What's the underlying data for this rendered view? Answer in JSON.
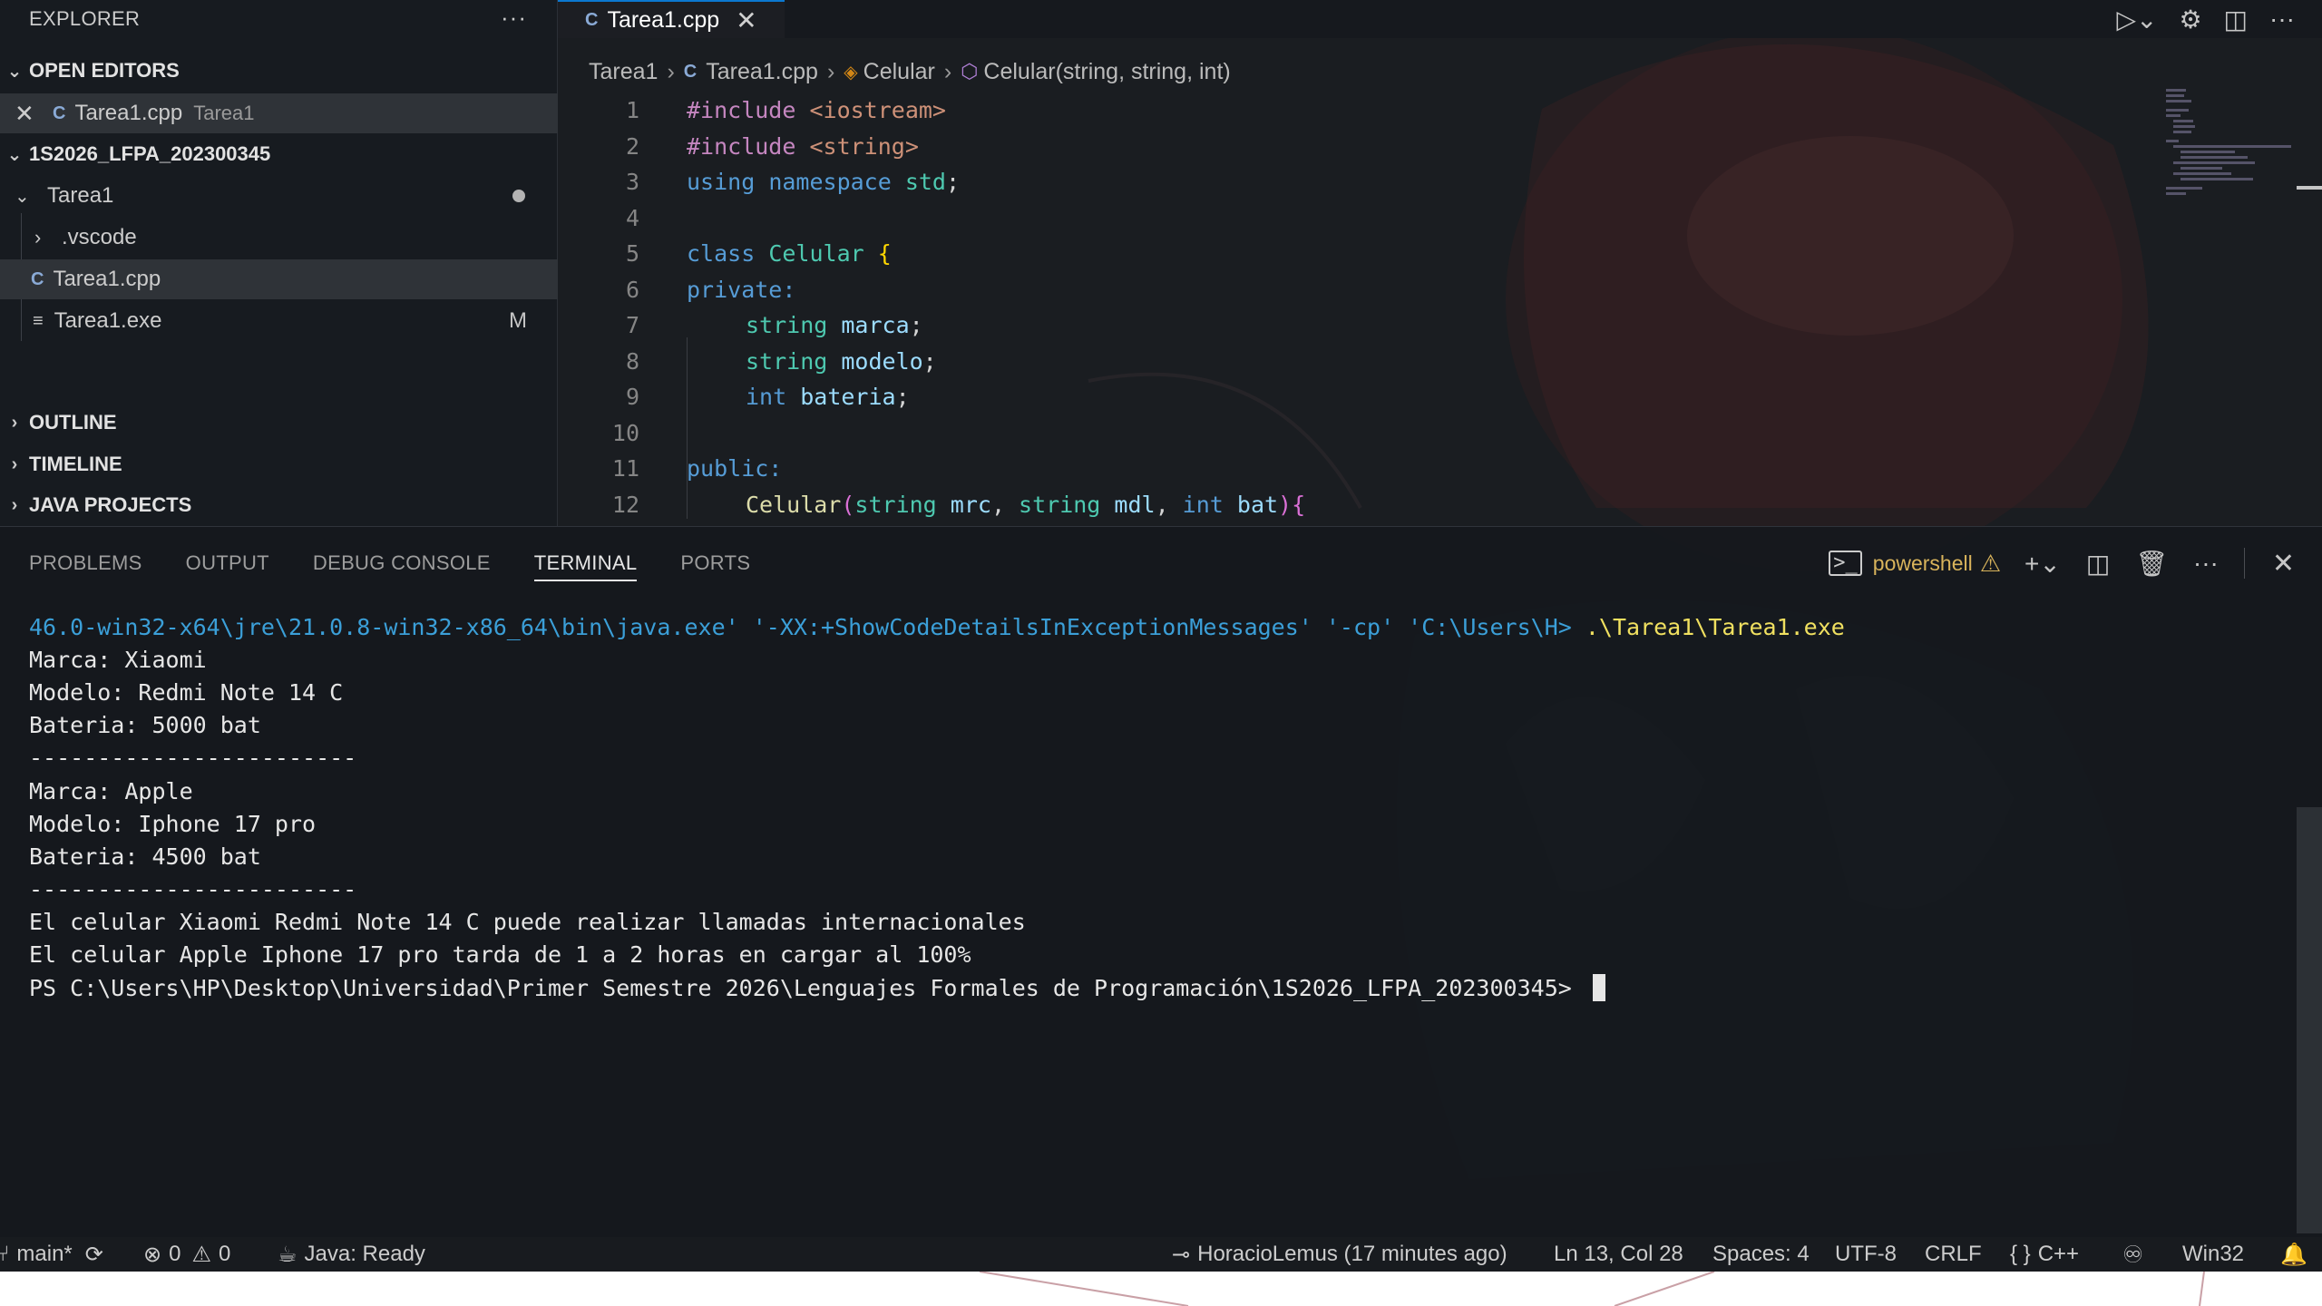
{
  "sidebar": {
    "title": "EXPLORER",
    "more": "···",
    "open_editors": {
      "header": "OPEN EDITORS",
      "items": [
        {
          "name": "Tarea1.cpp",
          "desc": "Tarea1"
        }
      ]
    },
    "workspace": {
      "header": "1S2026_LFPA_202300345",
      "folder": "Tarea1",
      "children": [
        {
          "name": ".vscode"
        },
        {
          "name": "Tarea1.cpp"
        },
        {
          "name": "Tarea1.exe",
          "badge": "M"
        }
      ]
    },
    "sections": [
      "OUTLINE",
      "TIMELINE",
      "JAVA PROJECTS"
    ]
  },
  "editor": {
    "tab": {
      "name": "Tarea1.cpp",
      "icon": "cpp-icon"
    },
    "breadcrumb": {
      "folder": "Tarea1",
      "file": "Tarea1.cpp",
      "class": "Celular",
      "method": "Celular(string, string, int)"
    },
    "lines": [
      "1",
      "2",
      "3",
      "4",
      "5",
      "6",
      "7",
      "8",
      "9",
      "10",
      "11",
      "12"
    ],
    "code": {
      "l1": {
        "a": "#include ",
        "b": "<iostream>"
      },
      "l2": {
        "a": "#include ",
        "b": "<string>"
      },
      "l3": {
        "a": "using ",
        "b": "namespace ",
        "c": "std",
        "d": ";"
      },
      "l5": {
        "a": "class ",
        "b": "Celular ",
        "c": "{"
      },
      "l6": {
        "a": "private:"
      },
      "l7": {
        "a": "string ",
        "b": "marca",
        "c": ";"
      },
      "l8": {
        "a": "string ",
        "b": "modelo",
        "c": ";"
      },
      "l9": {
        "a": "int ",
        "b": "bateria",
        "c": ";"
      },
      "l11": {
        "a": "public:"
      },
      "l12": {
        "a": "Celular",
        "b": "(",
        "c": "string ",
        "d": "mrc",
        "e": ", ",
        "f": "string ",
        "g": "mdl",
        "h": ", ",
        "i": "int ",
        "j": "bat",
        "k": "){"
      }
    }
  },
  "panel": {
    "tabs": [
      "PROBLEMS",
      "OUTPUT",
      "DEBUG CONSOLE",
      "TERMINAL",
      "PORTS"
    ],
    "active_tab": "TERMINAL",
    "shell": "powershell",
    "terminal": {
      "cmd_prefix": "46.0-win32-x64\\jre\\21.0.8-win32-x86_64\\bin\\java.exe' '-XX:+ShowCodeDetailsInExceptionMessages' '-cp' 'C:\\Users\\H> ",
      "cmd_run": ".\\Tarea1\\Tarea1.exe",
      "output": [
        "Marca: Xiaomi",
        "Modelo: Redmi Note 14 C",
        "Bateria: 5000 bat",
        "------------------------",
        "Marca: Apple",
        "Modelo: Iphone 17 pro",
        "Bateria: 4500 bat",
        "------------------------",
        "El celular Xiaomi Redmi Note 14 C puede realizar llamadas internacionales",
        "El celular Apple Iphone 17 pro tarda de 1 a 2 horas en cargar al 100%"
      ],
      "prompt": "PS C:\\Users\\HP\\Desktop\\Universidad\\Primer Semestre 2026\\Lenguajes Formales de Programación\\1S2026_LFPA_202300345> "
    }
  },
  "statusbar": {
    "branch": "main*",
    "errors": "0",
    "warnings": "0",
    "java": "Java: Ready",
    "blame": "HoracioLemus (17 minutes ago)",
    "position": "Ln 13, Col 28",
    "spaces": "Spaces: 4",
    "encoding": "UTF-8",
    "eol": "CRLF",
    "language": "C++",
    "platform": "Win32"
  },
  "colors": {
    "background": "#1a1d21",
    "accent": "#0b78d0",
    "terminal_path": "#3b9fd8",
    "terminal_cmd": "#f0e060",
    "warning": "#d8b35b"
  }
}
